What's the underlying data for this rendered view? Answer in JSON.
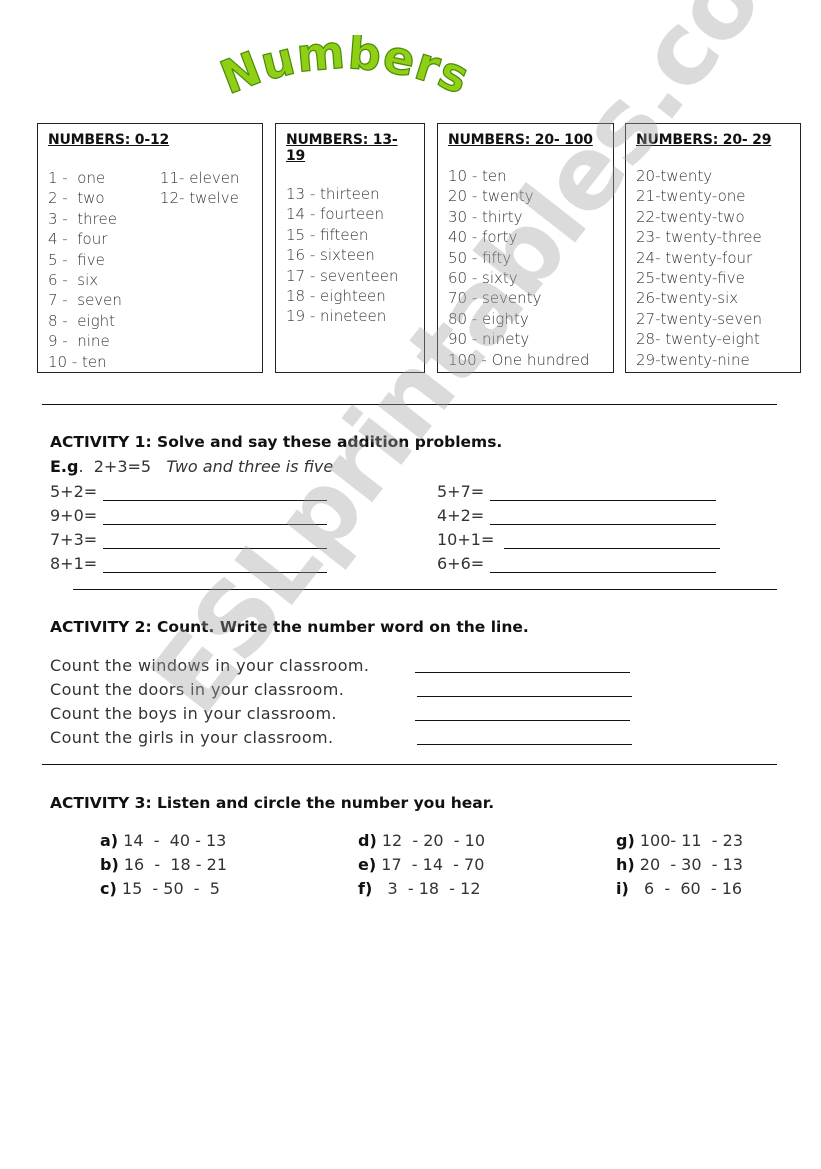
{
  "title": "Numbers",
  "colors": {
    "title_fill": "#8fcf16",
    "title_stroke": "#4a8a05"
  },
  "boxes": [
    {
      "heading": "NUMBERS: 0-12",
      "col1": [
        "1 -  one",
        "2 -  two",
        "3 -  three",
        "4 -  four",
        "5 -  five",
        "6 -  six",
        "7 -  seven",
        "8 -  eight",
        "9 -  nine",
        "10 - ten"
      ],
      "col2": [
        "11- eleven",
        "12- twelve"
      ]
    },
    {
      "heading": "NUMBERS: 13-19",
      "col1": [
        "13 - thirteen",
        "14 - fourteen",
        "15 - fifteen",
        "16 - sixteen",
        "17 - seventeen",
        "18 - eighteen",
        "19 - nineteen"
      ]
    },
    {
      "heading": "NUMBERS: 20- 100",
      "col1": [
        "10 - ten",
        "20 - twenty",
        "30 - thirty",
        "40 - forty",
        "50 - fifty",
        "60 - sixty",
        "70 - seventy",
        "80 - eighty",
        "90 - ninety",
        "100 - One hundred"
      ]
    },
    {
      "heading": "NUMBERS: 20- 29",
      "col1": [
        "20-twenty",
        "21-twenty-one",
        "22-twenty-two",
        "23- twenty-three",
        "24- twenty-four",
        "25-twenty-five",
        "26-twenty-six",
        "27-twenty-seven",
        "28- twenty-eight",
        "29-twenty-nine"
      ]
    }
  ],
  "activity1": {
    "title": "ACTIVITY 1:  Solve and say these addition problems.",
    "example_label": "E.g",
    "example_sum": " 2+3=5",
    "example_text": "Two and three is five",
    "left": [
      "5+2=",
      "9+0=",
      "7+3=",
      "8+1="
    ],
    "right": [
      "5+7=",
      "4+2=",
      "10+1=",
      "6+6="
    ]
  },
  "activity2": {
    "title": "ACTIVITY 2:  Count. Write the number word on the line.",
    "items": [
      "Count the windows in your classroom.",
      "Count the doors in your classroom.",
      "Count the boys in your classroom.",
      "Count the girls in your classroom."
    ]
  },
  "activity3": {
    "title": "ACTIVITY 3: Listen and circle the number you hear.",
    "items": [
      {
        "label": "a)",
        "text": " 14  -  40 - 13"
      },
      {
        "label": "b)",
        "text": " 16  -  18 - 21"
      },
      {
        "label": "c)",
        "text": " 15  - 50  -  5"
      },
      {
        "label": "d)",
        "text": " 12  - 20  - 10"
      },
      {
        "label": "e)",
        "text": " 17  - 14  - 70"
      },
      {
        "label": "f)",
        "text": "   3  - 18  - 12"
      },
      {
        "label": "g)",
        "text": " 100- 11  - 23"
      },
      {
        "label": "h)",
        "text": " 20  - 30  - 13"
      },
      {
        "label": "i)",
        "text": "   6  -  60  - 16"
      }
    ]
  },
  "watermark": "ESLprintables.com"
}
